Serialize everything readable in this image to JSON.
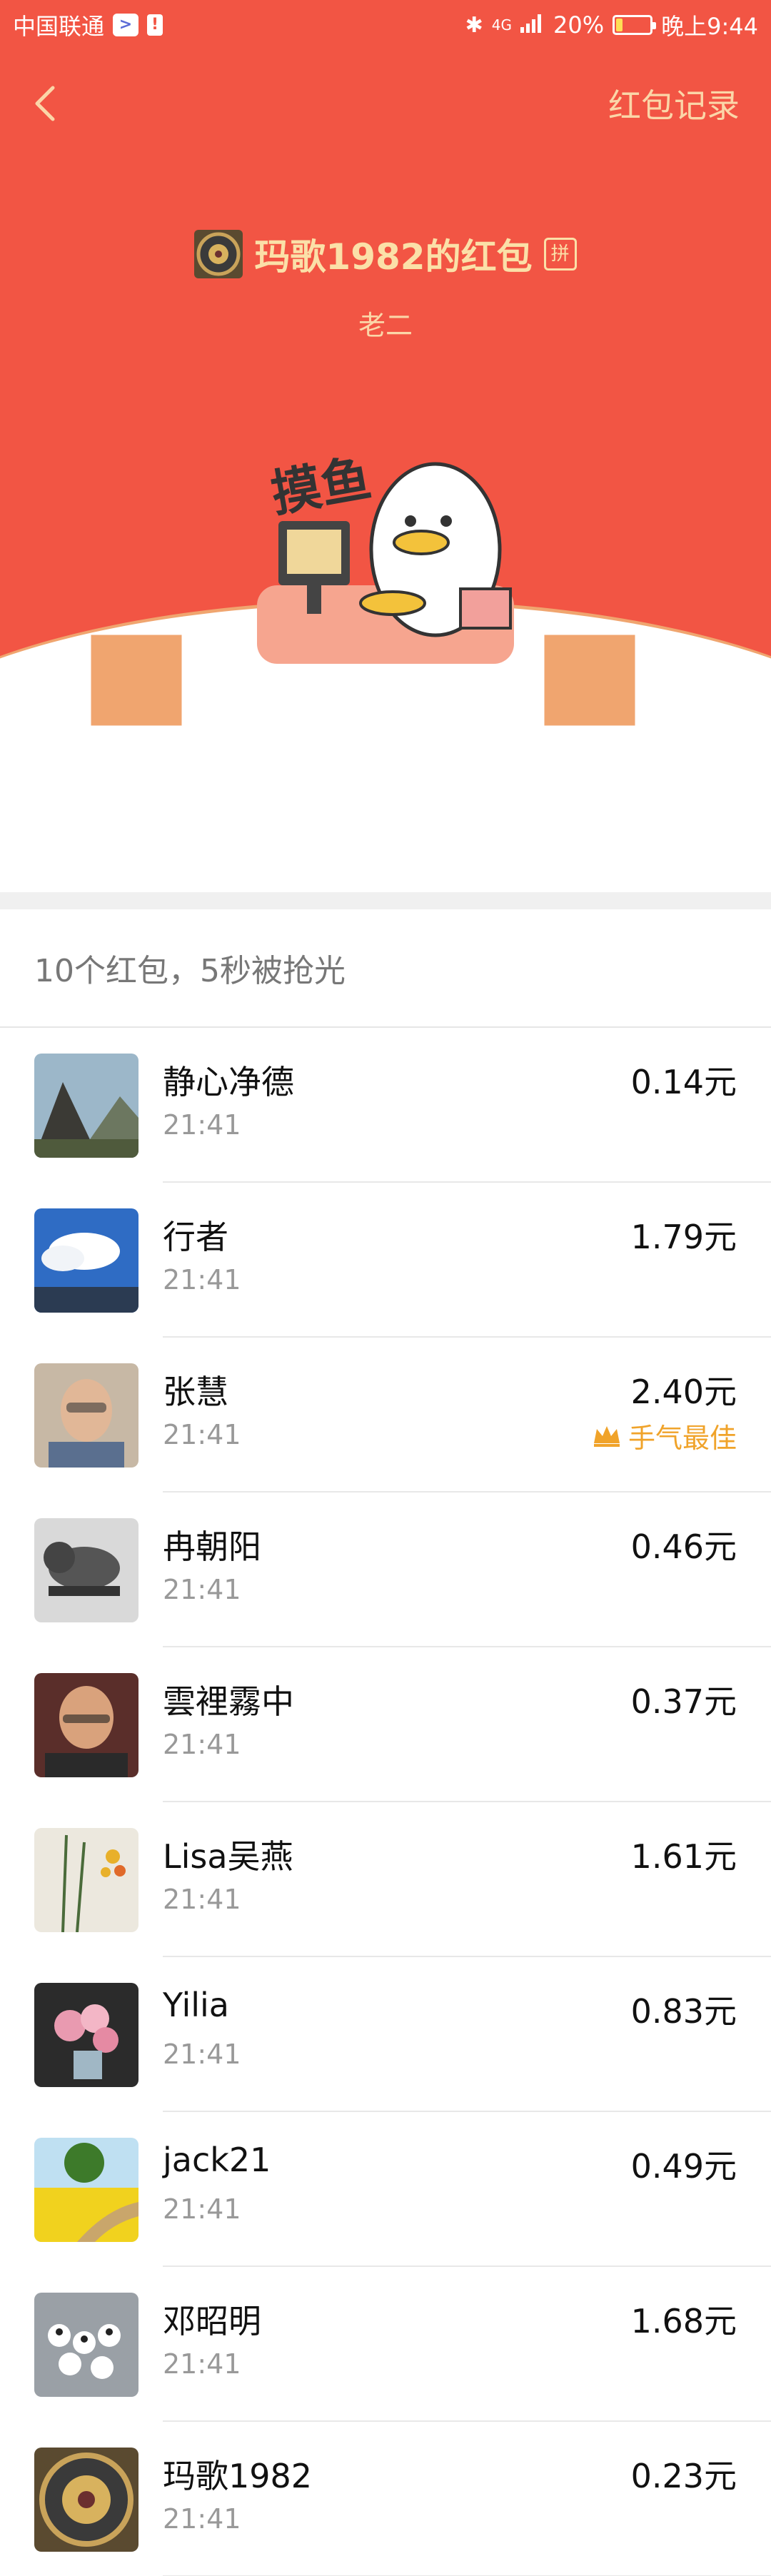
{
  "status_bar": {
    "carrier": "中国联通",
    "network": "4G",
    "battery": "20%",
    "battery_level": 0.2,
    "time": "晚上9:44"
  },
  "nav": {
    "back_icon": "chevron-left-icon",
    "record_link": "红包记录"
  },
  "packet": {
    "sender_name": "玛歌1982的红包",
    "pin_badge": "拼",
    "greeting": "老二",
    "sticker_text": "摸鱼"
  },
  "summary": "10个红包，5秒被抢光",
  "recipients": [
    {
      "name": "静心净德",
      "time": "21:41",
      "amount": "0.14元",
      "best": ""
    },
    {
      "name": "行者",
      "time": "21:41",
      "amount": "1.79元",
      "best": ""
    },
    {
      "name": "张慧",
      "time": "21:41",
      "amount": "2.40元",
      "best": "手气最佳"
    },
    {
      "name": "冉朝阳",
      "time": "21:41",
      "amount": "0.46元",
      "best": ""
    },
    {
      "name": "雲裡霧中",
      "time": "21:41",
      "amount": "0.37元",
      "best": ""
    },
    {
      "name": "Lisa吴燕",
      "time": "21:41",
      "amount": "1.61元",
      "best": ""
    },
    {
      "name": "Yilia",
      "time": "21:41",
      "amount": "0.83元",
      "best": ""
    },
    {
      "name": "jack21",
      "time": "21:41",
      "amount": "0.49元",
      "best": ""
    },
    {
      "name": "邓昭明",
      "time": "21:41",
      "amount": "1.68元",
      "best": ""
    },
    {
      "name": "玛歌1982",
      "time": "21:41",
      "amount": "0.23元",
      "best": ""
    }
  ],
  "colors": {
    "hero_red": "#f25544",
    "gold_text": "#fbe0a8",
    "best_gold": "#f0a32a"
  }
}
